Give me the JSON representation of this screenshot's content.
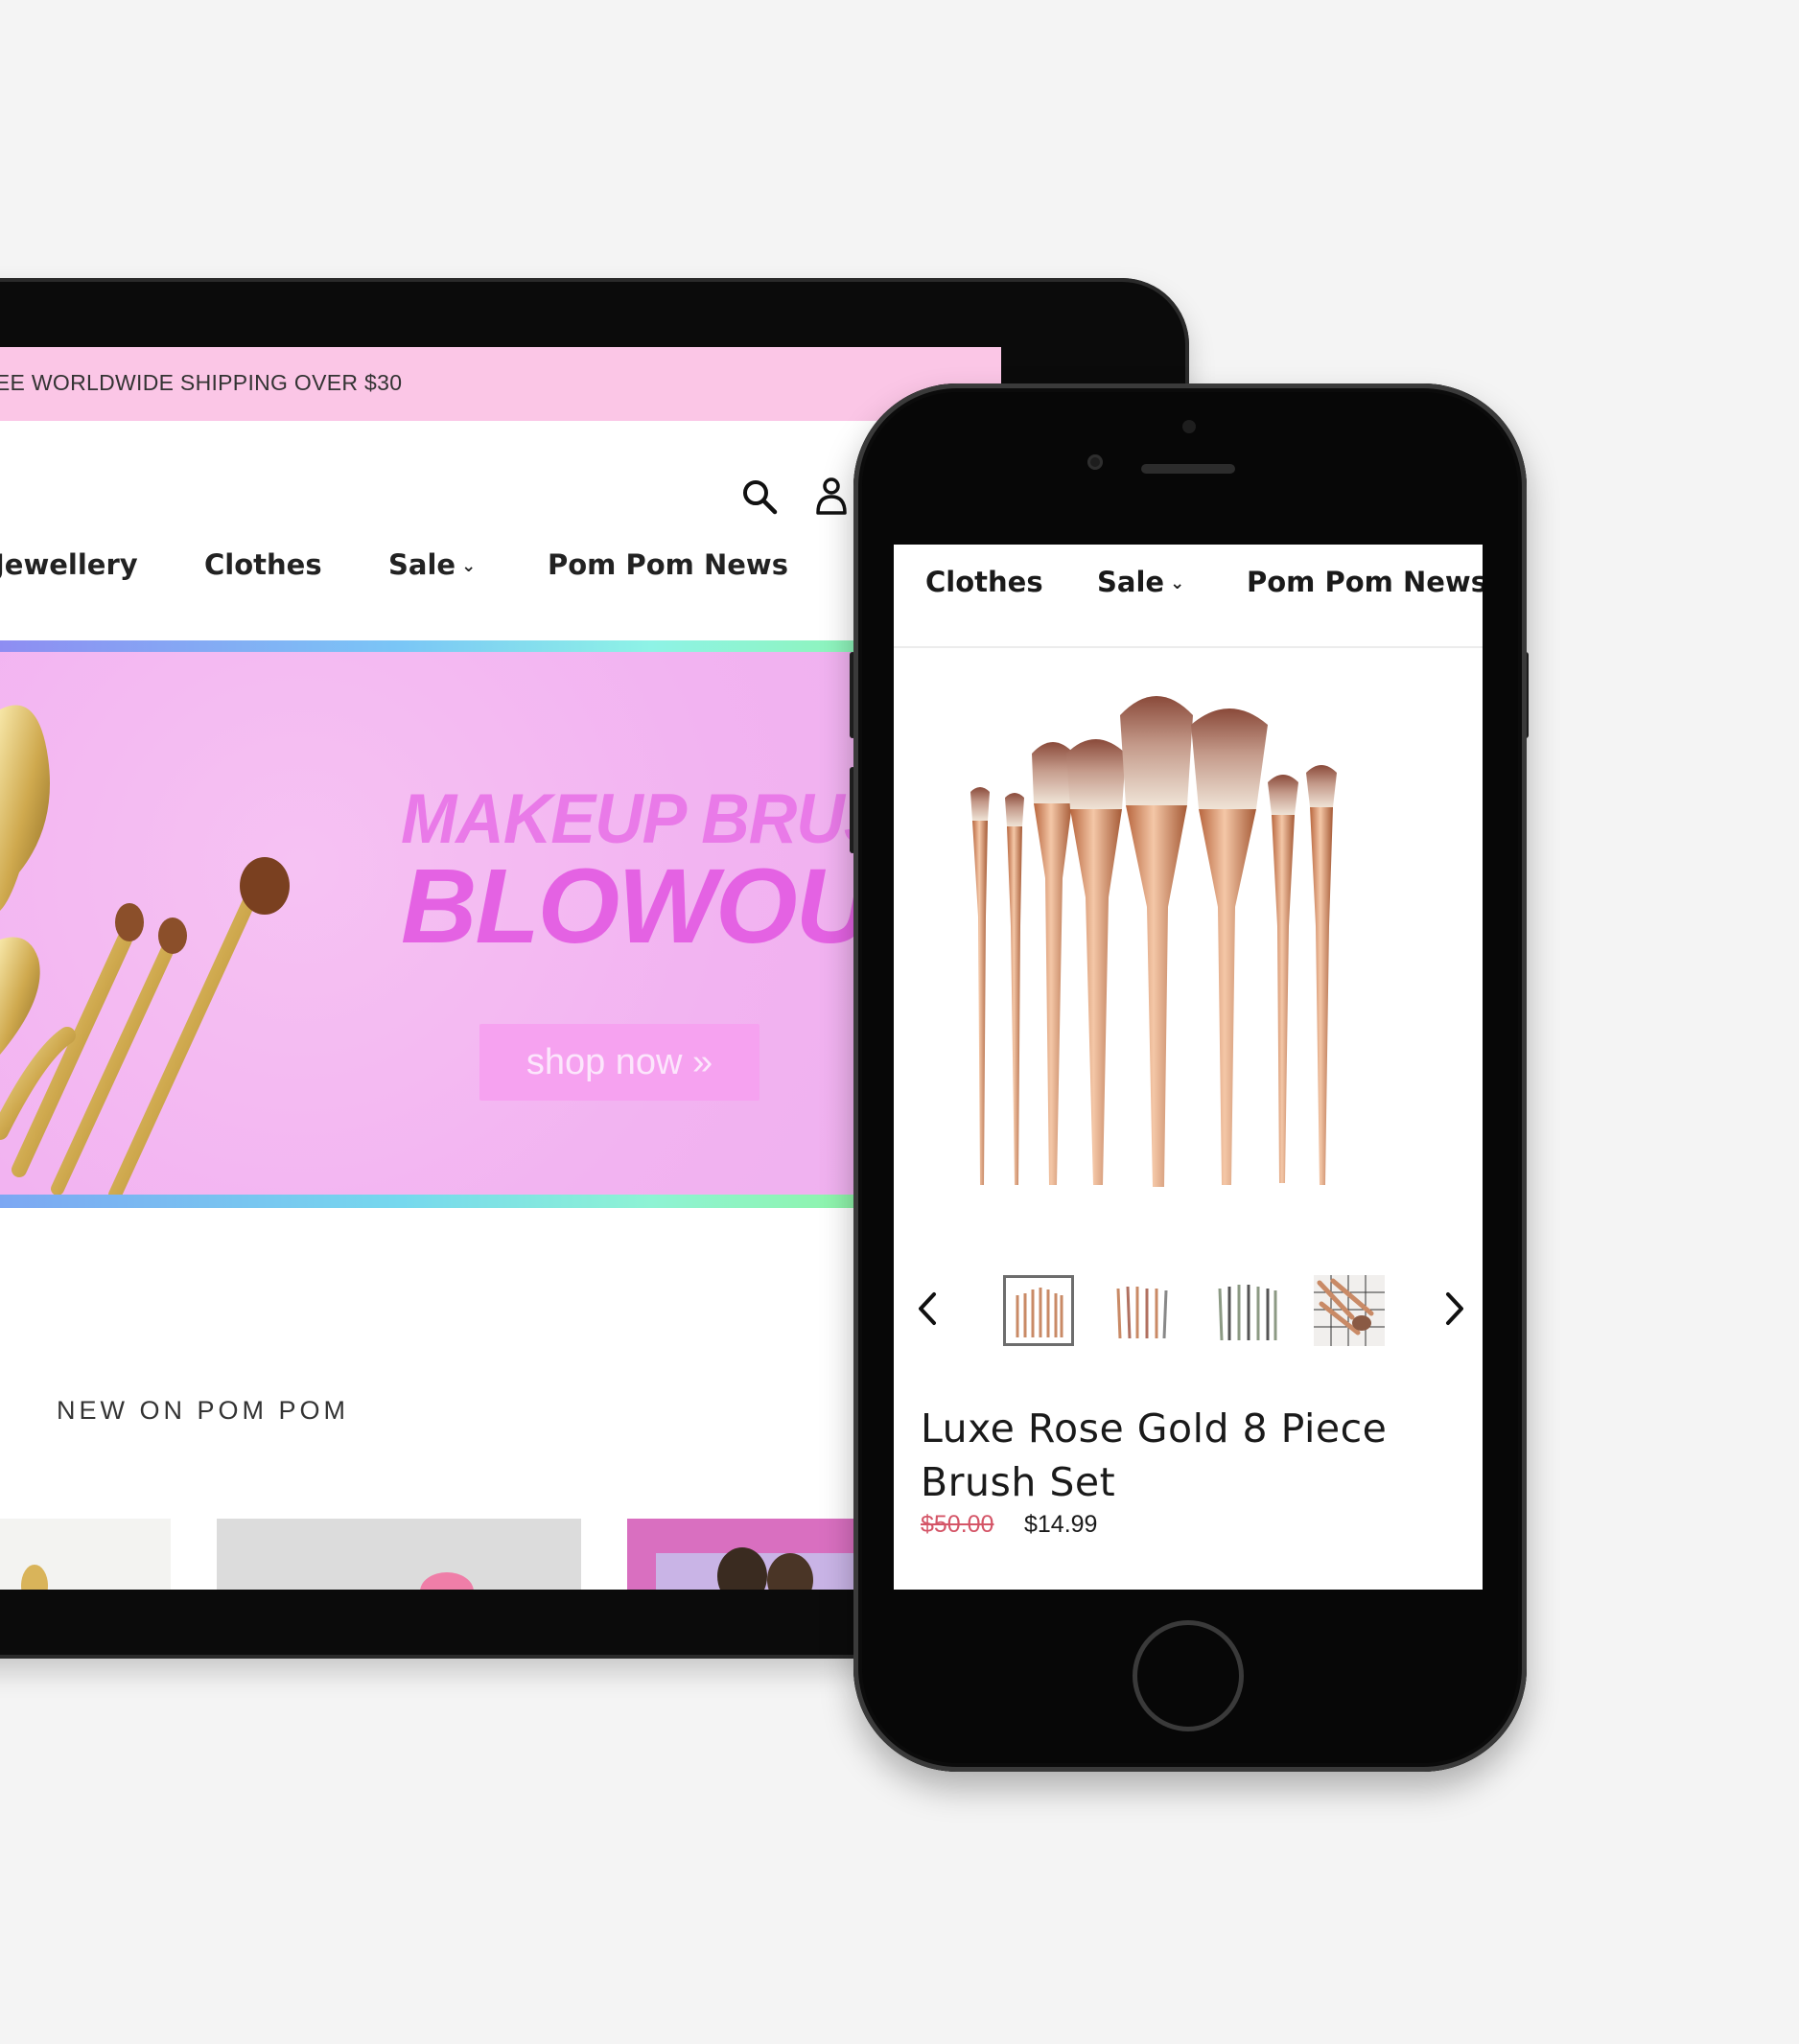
{
  "tablet": {
    "promo_bar": {
      "text": "REE WORLDWIDE SHIPPING OVER $30"
    },
    "header": {
      "icons": [
        "search-icon",
        "account-icon"
      ]
    },
    "nav": {
      "items": [
        {
          "label": "Jewellery"
        },
        {
          "label": "Clothes"
        },
        {
          "label": "Sale",
          "has_dropdown": true
        },
        {
          "label": "Pom Pom News"
        }
      ]
    },
    "hero": {
      "line1": "MAKEUP BRUSH",
      "line2": "BLOWOUT",
      "cta_label": "shop now »",
      "colors": {
        "background": "#f2b3f1",
        "headline": "#e462e3",
        "cta": "#f6a2f0"
      }
    },
    "section": {
      "heading": "NEW ON POM POM"
    }
  },
  "phone": {
    "nav": {
      "items": [
        {
          "label": "Clothes"
        },
        {
          "label": "Sale",
          "has_dropdown": true
        },
        {
          "label": "Pom Pom News"
        }
      ]
    },
    "product": {
      "title": "Luxe Rose Gold 8 Piece Brush Set",
      "old_price": "$50.00",
      "price": "$14.99",
      "thumbnails_count": 4,
      "selected_thumbnail": 1,
      "colors": {
        "old_price": "#d45567",
        "handle": "#d8926c"
      }
    },
    "gallery_controls": [
      "chevron-left-icon",
      "chevron-right-icon"
    ]
  }
}
